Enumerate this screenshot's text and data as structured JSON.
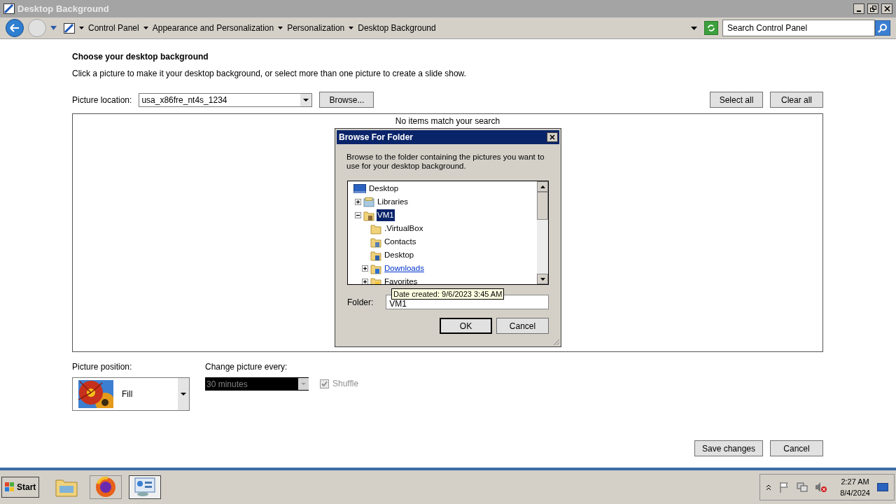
{
  "window": {
    "title": "Desktop Background"
  },
  "address_bar": {
    "breadcrumbs": [
      "Control Panel",
      "Appearance and Personalization",
      "Personalization",
      "Desktop Background"
    ],
    "search_placeholder": "Search Control Panel"
  },
  "heading": "Choose your desktop background",
  "description": "Click a picture to make it your desktop background, or select more than one picture to create a slide show.",
  "picture_location": {
    "label": "Picture location:",
    "value": "usa_x86fre_nt4s_1234",
    "browse": "Browse..."
  },
  "selection_buttons": [
    "Select all",
    "Clear all"
  ],
  "empty_message": "No items match your search",
  "picture_position": {
    "label": "Picture position:",
    "value": "Fill"
  },
  "change_picture": {
    "label": "Change picture every:",
    "value": "30 minutes",
    "disabled": true
  },
  "shuffle": {
    "label": "Shuffle",
    "checked": true,
    "disabled": true
  },
  "footer_buttons": [
    "Save changes",
    "Cancel"
  ],
  "dialog": {
    "title": "Browse For Folder",
    "instructions": "Browse to the folder containing the pictures you want to use for your desktop background.",
    "tree": [
      {
        "label": "Desktop",
        "kind": "desktop",
        "selected": false,
        "hot": false,
        "children": [
          {
            "label": "Libraries",
            "kind": "library",
            "expanded": false,
            "selected": false,
            "hot": false
          },
          {
            "label": "VM1",
            "kind": "user",
            "expanded": true,
            "selected": true,
            "hot": false,
            "children": [
              {
                "label": ".VirtualBox",
                "kind": "folder",
                "selected": false,
                "hot": false
              },
              {
                "label": "Contacts",
                "kind": "contacts",
                "selected": false,
                "hot": false
              },
              {
                "label": "Desktop",
                "kind": "desktop-folder",
                "selected": false,
                "hot": false
              },
              {
                "label": "Downloads",
                "kind": "downloads",
                "expanded": false,
                "selected": false,
                "hot": true
              },
              {
                "label": "Favorites",
                "kind": "favorites",
                "expanded": false,
                "selected": false,
                "hot": false
              }
            ]
          }
        ]
      }
    ],
    "folder_label": "Folder:",
    "folder_value": "VM1",
    "buttons": [
      "OK",
      "Cancel"
    ],
    "tooltip": "Date created: 9/6/2023 3:45 AM"
  },
  "taskbar": {
    "start": "Start",
    "clock_time": "2:27 AM",
    "clock_date": "8/4/2024"
  }
}
